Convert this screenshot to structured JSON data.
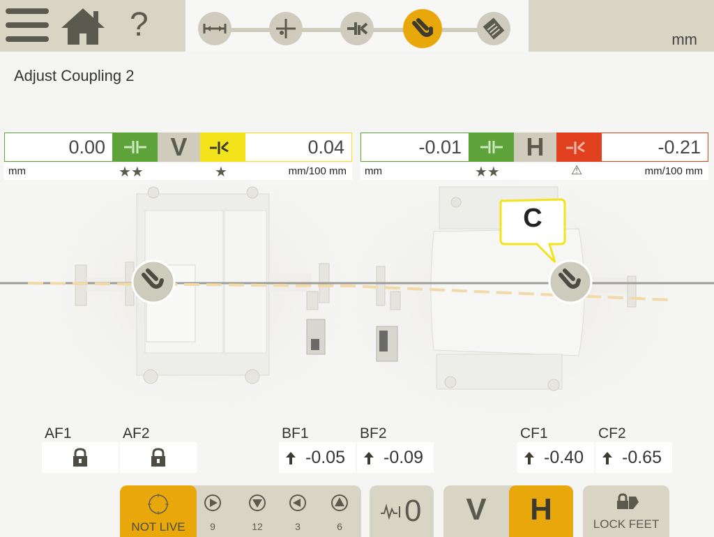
{
  "header": {
    "unit": "mm",
    "steps": [
      "dimensions-icon",
      "measure-icon",
      "result-icon",
      "adjust-coupling-icon",
      "report-icon"
    ]
  },
  "page_title": "Adjust Coupling 2",
  "vertical": {
    "offset_value": "0.00",
    "offset_unit": "mm",
    "label": "V",
    "angle_value": "0.04",
    "angle_unit": "mm/100 mm",
    "offset_quality": "★★",
    "angle_quality": "★"
  },
  "horizontal": {
    "offset_value": "-0.01",
    "offset_unit": "mm",
    "label": "H",
    "angle_value": "-0.21",
    "angle_unit": "mm/100 mm",
    "offset_quality": "★★",
    "angle_quality": "⚠"
  },
  "callout": "C",
  "feet": {
    "AF1": {
      "label": "AF1",
      "locked": true
    },
    "AF2": {
      "label": "AF2",
      "locked": true
    },
    "BF1": {
      "label": "BF1",
      "value": "-0.05"
    },
    "BF2": {
      "label": "BF2",
      "value": "-0.09"
    },
    "CF1": {
      "label": "CF1",
      "value": "-0.40"
    },
    "CF2": {
      "label": "CF2",
      "value": "-0.65"
    }
  },
  "bottom": {
    "not_live": "NOT LIVE",
    "clock": [
      "9",
      "12",
      "3",
      "6"
    ],
    "zero": "0",
    "v": "V",
    "h": "H",
    "lock_feet": "LOCK FEET"
  },
  "colors": {
    "accent": "#e8a80c",
    "green": "#5ea33a",
    "yellow": "#f2e31a",
    "red": "#e0401e",
    "bar": "#d8d5c4"
  }
}
